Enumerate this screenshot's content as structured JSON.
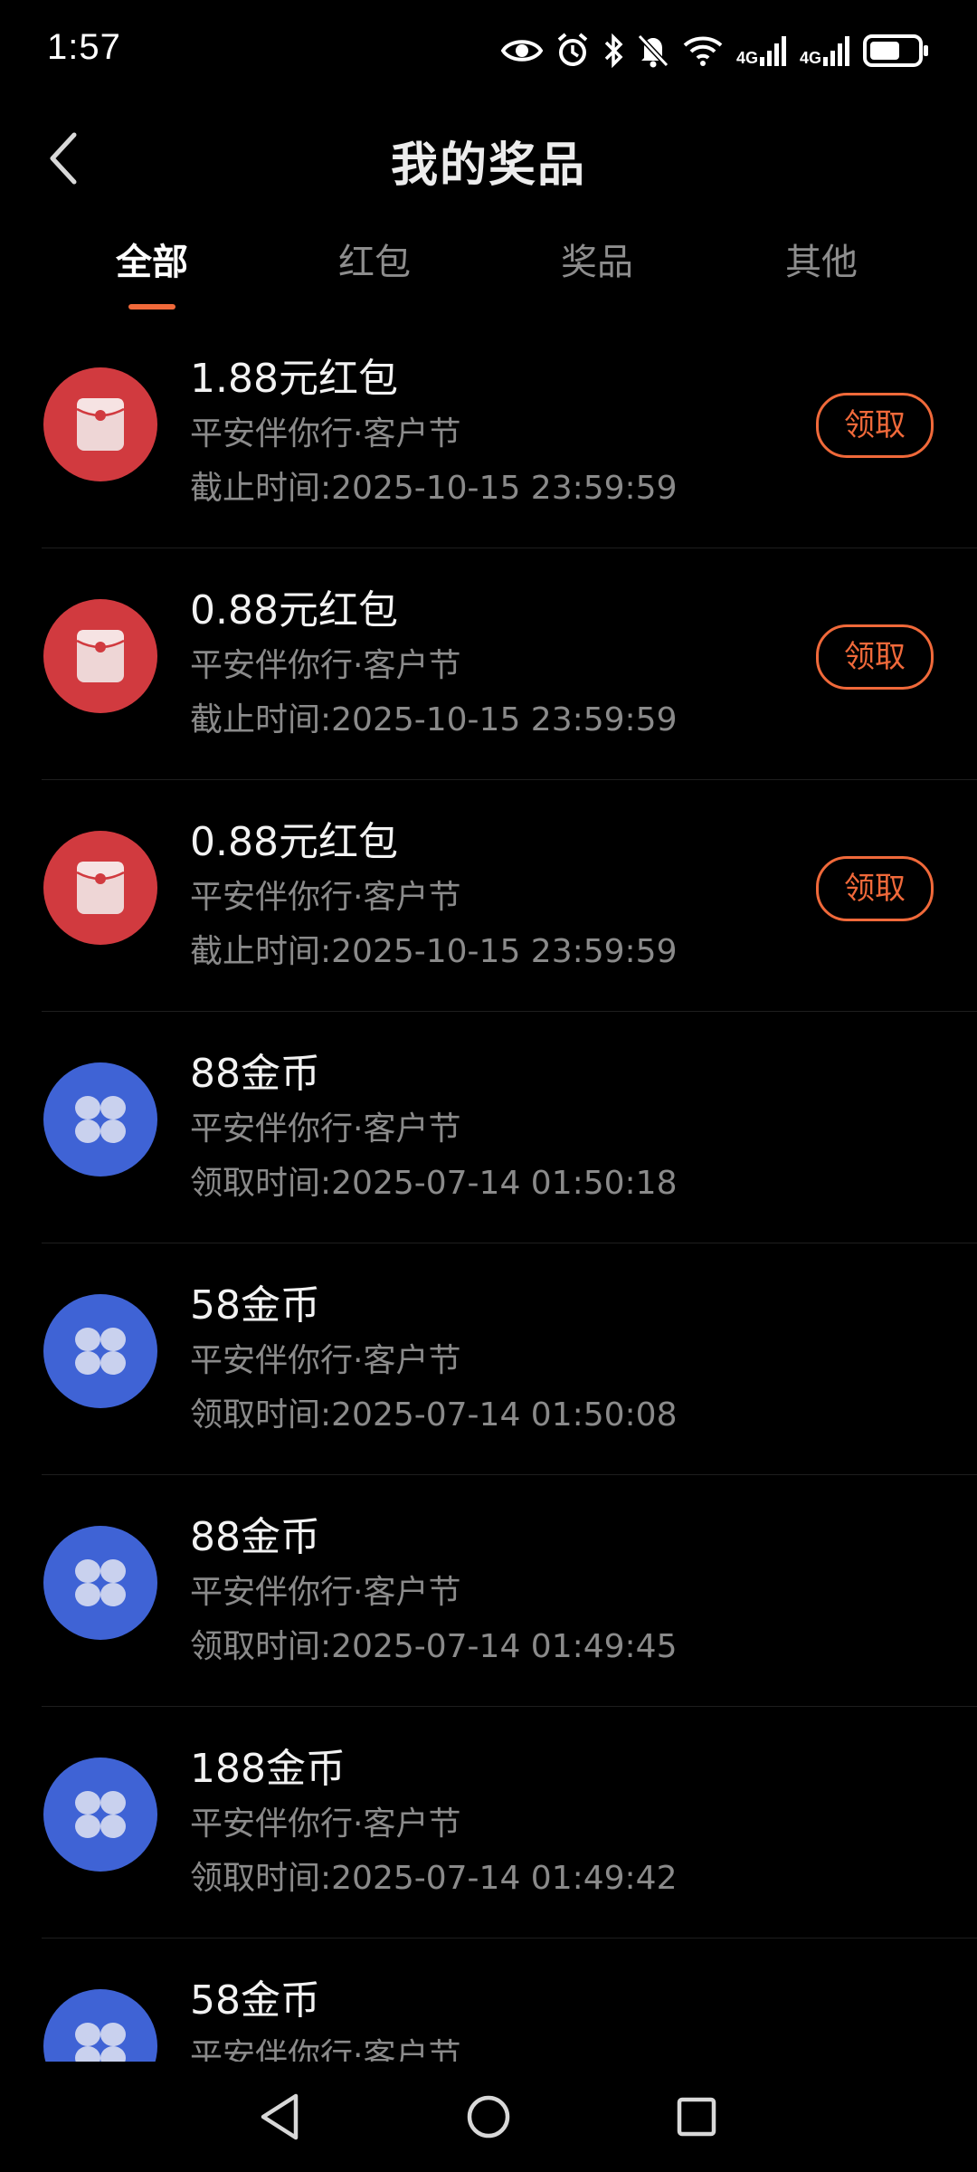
{
  "status_bar": {
    "time": "1:57",
    "network_1": "4G",
    "network_2": "4G",
    "icons": [
      "eye-icon",
      "alarm-icon",
      "bluetooth-icon",
      "mute-icon",
      "wifi-icon",
      "signal-icon",
      "signal-icon",
      "battery-icon"
    ]
  },
  "header": {
    "title": "我的奖品",
    "back_icon": "chevron-left-icon"
  },
  "tabs": [
    {
      "label": "全部",
      "active": true
    },
    {
      "label": "红包",
      "active": false
    },
    {
      "label": "奖品",
      "active": false
    },
    {
      "label": "其他",
      "active": false
    }
  ],
  "colors": {
    "accent": "#f0693a",
    "red_packet": "#d13a3f",
    "coin": "#3f63d5",
    "background": "#000000"
  },
  "items": [
    {
      "type": "red-packet",
      "title": "1.88元红包",
      "source": "平安伴你行·客户节",
      "time": "截止时间:2025-10-15 23:59:59",
      "action": "领取"
    },
    {
      "type": "red-packet",
      "title": "0.88元红包",
      "source": "平安伴你行·客户节",
      "time": "截止时间:2025-10-15 23:59:59",
      "action": "领取"
    },
    {
      "type": "red-packet",
      "title": "0.88元红包",
      "source": "平安伴你行·客户节",
      "time": "截止时间:2025-10-15 23:59:59",
      "action": "领取"
    },
    {
      "type": "coin",
      "title": "88金币",
      "source": "平安伴你行·客户节",
      "time": "领取时间:2025-07-14 01:50:18"
    },
    {
      "type": "coin",
      "title": "58金币",
      "source": "平安伴你行·客户节",
      "time": "领取时间:2025-07-14 01:50:08"
    },
    {
      "type": "coin",
      "title": "88金币",
      "source": "平安伴你行·客户节",
      "time": "领取时间:2025-07-14 01:49:45"
    },
    {
      "type": "coin",
      "title": "188金币",
      "source": "平安伴你行·客户节",
      "time": "领取时间:2025-07-14 01:49:42"
    },
    {
      "type": "coin",
      "title": "58金币",
      "source": "平安伴你行·客户节",
      "time": ""
    }
  ],
  "nav_bar": {
    "icons": [
      "back-triangle-icon",
      "home-circle-icon",
      "recents-square-icon"
    ]
  }
}
